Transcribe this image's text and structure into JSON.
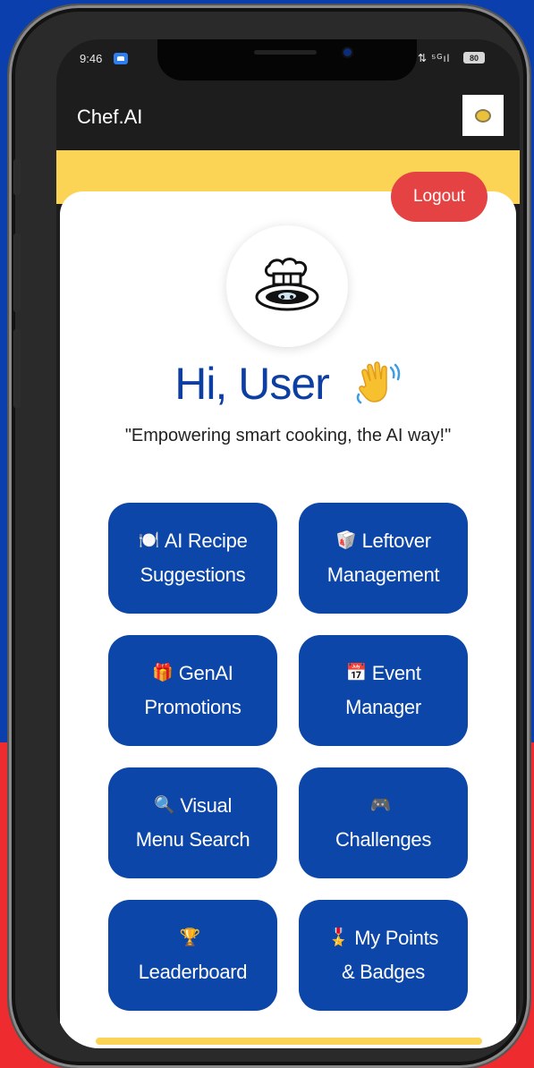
{
  "colors": {
    "background_blue": "#0c3fae",
    "background_red": "#ee2b2f",
    "primary": "#0b46a8",
    "accent_yellow": "#fcd455",
    "logout": "#e54343"
  },
  "status_bar": {
    "time": "9:46",
    "signal": "⇅ ⁵ᴳıl",
    "battery": "80"
  },
  "app_bar": {
    "title": "Chef.AI",
    "profile_icon": "profile-thumbnail-icon"
  },
  "header": {
    "logout_label": "Logout",
    "greeting": "Hi, User",
    "greeting_icon": "waving-hand-icon",
    "tagline": "\"Empowering smart cooking, the AI way!\""
  },
  "features": [
    {
      "icon": "🍽️",
      "line1": "AI Recipe",
      "line2": "Suggestions"
    },
    {
      "icon": "🥡",
      "line1": "Leftover",
      "line2": "Management"
    },
    {
      "icon": "🎁",
      "line1": "GenAI",
      "line2": "Promotions"
    },
    {
      "icon": "📅",
      "line1": "Event",
      "line2": "Manager"
    },
    {
      "icon": "🔍",
      "line1": "Visual",
      "line2": "Menu Search"
    },
    {
      "icon": "🎮",
      "line1": "",
      "line2": "Challenges"
    },
    {
      "icon": "🏆",
      "line1": "",
      "line2": "Leaderboard"
    },
    {
      "icon": "🎖️",
      "line1": "My Points",
      "line2": "& Badges"
    }
  ]
}
